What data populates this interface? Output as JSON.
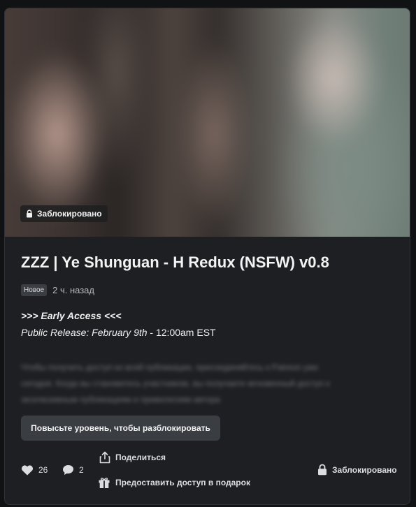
{
  "post": {
    "locked_badge": "Заблокировано",
    "title": "ZZZ | Ye Shunguan - H Redux (NSFW) v0.8",
    "new_badge": "Новое",
    "time": "2 ч. назад",
    "early_access": ">>> Early Access <<<",
    "release_italic": "Public Release: February 9th",
    "release_rest": " - 12:00am EST",
    "blurred_lines": [
      "Чтобы получить доступ ко всей публикации, присоединяйтесь к Patreon уже",
      "сегодня. Когда вы становитесь участником, вы получаете мгновенный доступ к",
      "эксклюзивным публикациям и привилегиям автора"
    ],
    "upgrade_button": "Повысьте уровень, чтобы разблокировать"
  },
  "footer": {
    "likes": "26",
    "comments": "2",
    "share": "Поделиться",
    "gift": "Предоставить доступ в подарок",
    "locked": "Заблокировано"
  },
  "icons": {
    "lock": "lock-icon",
    "heart": "heart-icon",
    "comment": "comment-icon",
    "share": "share-icon",
    "gift": "gift-icon"
  }
}
